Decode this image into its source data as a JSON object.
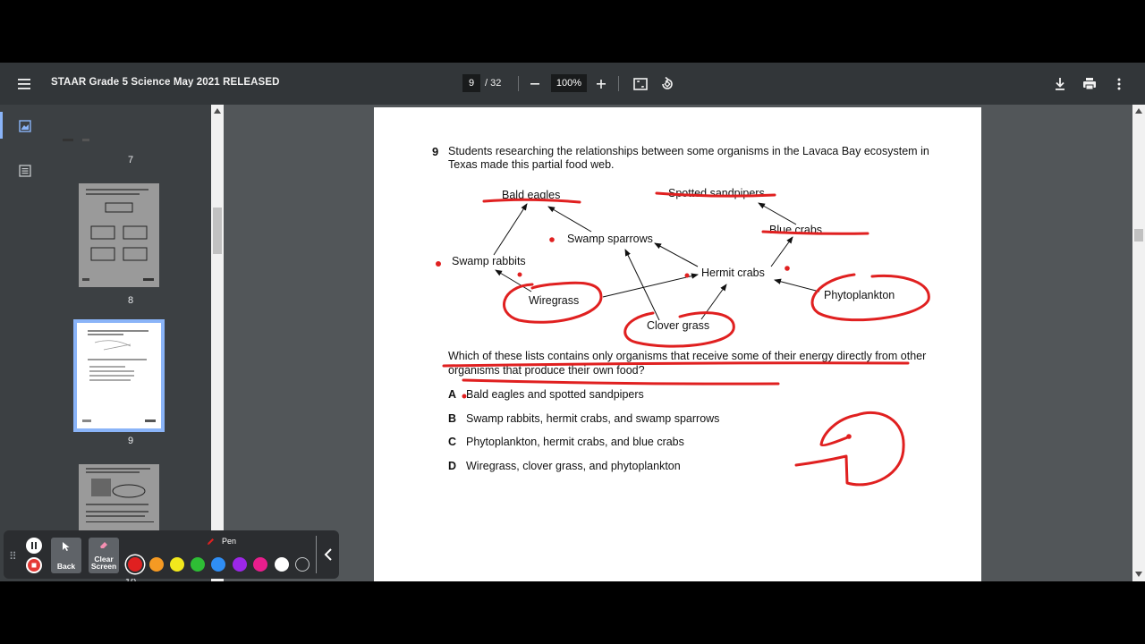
{
  "app": {
    "title": "STAAR Grade 5 Science May 2021 RELEASED",
    "current_page": "9",
    "page_separator": "/ 32",
    "zoom": "100%"
  },
  "icons": {
    "menu": "hamburger-menu-icon",
    "zoom_out": "minus-icon",
    "zoom_in": "plus-icon",
    "fit": "fit-to-page-icon",
    "rotate": "rotate-icon",
    "download": "download-icon",
    "print": "print-icon",
    "more": "more-vert-icon"
  },
  "sidebar": {
    "thumb_numbers": [
      "7",
      "8",
      "9",
      "10"
    ],
    "selected_page": "9"
  },
  "question": {
    "number": "9",
    "text": "Students researching the relationships between some organisms in the Lavaca Bay ecosystem in Texas made this partial food web.",
    "organisms": {
      "bald_eagles": "Bald eagles",
      "spotted_sandpipers": "Spotted sandpipers",
      "swamp_sparrows": "Swamp sparrows",
      "blue_crabs": "Blue crabs",
      "swamp_rabbits": "Swamp rabbits",
      "hermit_crabs": "Hermit crabs",
      "wiregrass": "Wiregrass",
      "phytoplankton": "Phytoplankton",
      "clover_grass": "Clover grass"
    },
    "prompt": "Which of these lists contains only organisms that receive some of their energy directly from other organisms that produce their own food?",
    "choices": [
      {
        "letter": "A",
        "text": "Bald eagles and spotted sandpipers"
      },
      {
        "letter": "B",
        "text": "Swamp rabbits, hermit crabs, and swamp sparrows"
      },
      {
        "letter": "C",
        "text": "Phytoplankton, hermit crabs, and blue crabs"
      },
      {
        "letter": "D",
        "text": "Wiregrass, clover grass, and phytoplankton"
      }
    ]
  },
  "annotation_toolbar": {
    "back_label": "Back",
    "clear_label_1": "Clear",
    "clear_label_2": "Screen",
    "pen_label": "Pen",
    "selected_color": "#e02020",
    "colors": [
      "#e02020",
      "#f59a23",
      "#f2e81d",
      "#2ebd35",
      "#2f8ef5",
      "#9c27e8",
      "#e91e8c",
      "#ffffff",
      "#2b2d30"
    ]
  },
  "colors": {
    "toolbar_bg": "#323639",
    "sidebar_bg": "#3c4043",
    "viewer_bg": "#525659",
    "accent": "#8ab4f8",
    "ink": "#e02020"
  }
}
